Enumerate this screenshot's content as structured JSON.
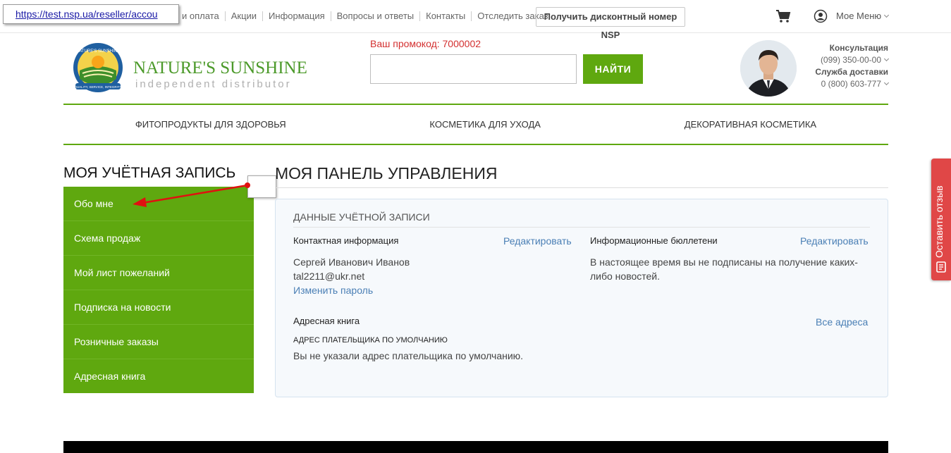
{
  "browser": {
    "url_tooltip": "https://test.nsp.ua/reseller/accou"
  },
  "topnav": {
    "items": [
      "и оплата",
      "Акции",
      "Информация",
      "Вопросы и ответы",
      "Контакты",
      "Отследить заказ"
    ],
    "discount_button": "Получить дисконтный номер NSP",
    "my_menu": "Мое Меню"
  },
  "header": {
    "logo_name": "NATURE'S SUNSHINE",
    "logo_sub": "independent distributor",
    "seal_text": "NATURE'S SUNSHINE",
    "seal_motto": "QUALITY, SERVICE, INTEGRITY",
    "promo": "Ваш промокод: 7000002",
    "search_placeholder": "",
    "search_button": "НАЙТИ",
    "consult_label": "Консультация",
    "consult_phone": "(099) 350-00-00",
    "delivery_label": "Служба доставки",
    "delivery_phone": "0 (800) 603-777"
  },
  "categories": [
    "ФИТОПРОДУКТЫ ДЛЯ ЗДОРОВЬЯ",
    "КОСМЕТИКА ДЛЯ УХОДА",
    "ДЕКОРАТИВНАЯ КОСМЕТИКА"
  ],
  "sidebar": {
    "title": "МОЯ УЧЁТНАЯ ЗАПИСЬ",
    "items": [
      "Обо мне",
      "Схема продаж",
      "Мой лист пожеланий",
      "Подписка на новости",
      "Розничные заказы",
      "Адресная книга"
    ]
  },
  "main": {
    "title": "МОЯ ПАНЕЛЬ УПРАВЛЕНИЯ",
    "panel_title": "ДАННЫЕ УЧЁТНОЙ ЗАПИСИ",
    "contact": {
      "title": "Контактная информация",
      "edit": "Редактировать",
      "name": "Сергей Иванович Иванов",
      "email": "tal2211@ukr.net",
      "change_password": "Изменить пароль"
    },
    "newsletter": {
      "title": "Информационные бюллетени",
      "edit": "Редактировать",
      "line1": "В настоящее время вы не подписаны на получение каких-",
      "line2": "либо новостей."
    },
    "address": {
      "title": "Адресная книга",
      "all": "Все адреса",
      "subtitle": "АДРЕС ПЛАТЕЛЬЩИКА ПО УМОЛЧАНИЮ",
      "text": "Вы не указали адрес плательщика по умолчанию."
    }
  },
  "feedback": {
    "label": "Оставить отзыв"
  },
  "colors": {
    "brand_green": "#5fa80f",
    "promo_red": "#d32f2f",
    "link_blue": "#4a7fb5",
    "feedback_red": "#e04747"
  }
}
